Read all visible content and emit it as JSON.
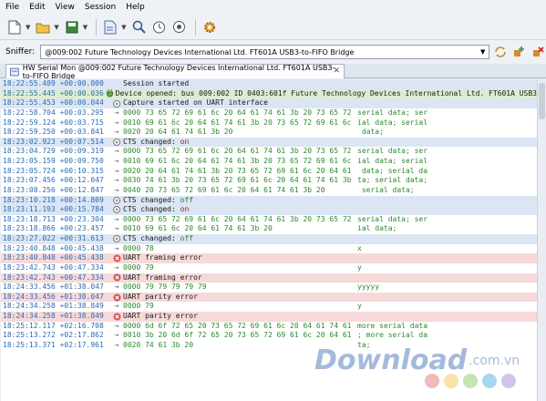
{
  "menu": {
    "file": "File",
    "edit": "Edit",
    "view": "View",
    "session": "Session",
    "help": "Help"
  },
  "toolbar": {
    "icons": [
      "new-icon",
      "open-folder-icon",
      "save-icon",
      "document-icon",
      "search-icon",
      "timer-icon",
      "capture-icon",
      "settings-gear-icon"
    ]
  },
  "sniffer": {
    "label": "Sniffer:",
    "value": "@009:002 Future Technology Devices International Ltd. FT601A USB3-to-FIFO Bridge"
  },
  "tab": {
    "title": "HW Serial Mon @009:002 Future Technology Devices International Ltd. FT601A USB3-to-FIFO Bridge",
    "close": "✕"
  },
  "log": [
    {
      "ts": "18:22:55.409 +00:00.000",
      "icon": "",
      "bg": "blue",
      "msg": "Session started"
    },
    {
      "ts": "18:22:55.445 +00:00.036",
      "icon": "plug",
      "bg": "green",
      "msg": "Device opened: bus 009:002 ID 0403:601f Future Technology Devices International Ltd. FT601A USB3"
    },
    {
      "ts": "18:22:55.453 +00:00.044",
      "icon": "info",
      "bg": "blue",
      "msg": "Capture started on UART interface"
    },
    {
      "ts": "18:22:58.704 +00:03.295",
      "icon": "arrow",
      "bg": "white",
      "hex": "0000 73 65 72 69 61 6c 20 64 61 74 61 3b 20 73 65 72",
      "asc": "serial data; ser"
    },
    {
      "ts": "18:22:59.124 +00:03.715",
      "icon": "arrow",
      "bg": "white",
      "hex": "0010 69 61 6c 20 64 61 74 61 3b 20 73 65 72 69 61 6c",
      "asc": "ial data; serial"
    },
    {
      "ts": "18:22:59.250 +00:03.841",
      "icon": "arrow",
      "bg": "white",
      "hex": "0020 20 64 61 74 61 3b 20",
      "asc": " data;"
    },
    {
      "ts": "18:23:02.923 +00:07.514",
      "icon": "info",
      "bg": "blue",
      "msg": "CTS changed: ",
      "state": "on",
      "state_type": "on"
    },
    {
      "ts": "18:23:04.729 +00:09.319",
      "icon": "arrow",
      "bg": "white",
      "hex": "0000 73 65 72 69 61 6c 20 64 61 74 61 3b 20 73 65 72",
      "asc": "serial data; ser"
    },
    {
      "ts": "18:23:05.159 +00:09.750",
      "icon": "arrow",
      "bg": "white",
      "hex": "0010 69 61 6c 20 64 61 74 61 3b 20 73 65 72 69 61 6c",
      "asc": "ial data; serial"
    },
    {
      "ts": "18:23:05.724 +00:10.315",
      "icon": "arrow",
      "bg": "white",
      "hex": "0020 20 64 61 74 61 3b 20 73 65 72 69 61 6c 20 64 61",
      "asc": " data; serial da"
    },
    {
      "ts": "18:23:07.456 +00:12.047",
      "icon": "arrow",
      "bg": "white",
      "hex": "0030 74 61 3b 20 73 65 72 69 61 6c 20 64 61 74 61 3b",
      "asc": "ta; serial data;"
    },
    {
      "ts": "18:23:08.256 +00:12.847",
      "icon": "arrow",
      "bg": "white",
      "hex": "0040 20 73 65 72 69 61 6c 20 64 61 74 61 3b 20",
      "asc": " serial data;"
    },
    {
      "ts": "18:23:10.218 +00:14.809",
      "icon": "info",
      "bg": "blue",
      "msg": "CTS changed: ",
      "state": "off",
      "state_type": "off"
    },
    {
      "ts": "18:23:11.193 +00:15.784",
      "icon": "info",
      "bg": "blue",
      "msg": "CTS changed: ",
      "state": "on",
      "state_type": "on"
    },
    {
      "ts": "18:23:18.713 +00:23.304",
      "icon": "arrow",
      "bg": "white",
      "hex": "0000 73 65 72 69 61 6c 20 64 61 74 61 3b 20 73 65 72",
      "asc": "serial data; ser"
    },
    {
      "ts": "18:23:18.866 +00:23.457",
      "icon": "arrow",
      "bg": "white",
      "hex": "0010 69 61 6c 20 64 61 74 61 3b 20",
      "asc": "ial data;"
    },
    {
      "ts": "18:23:27.022 +00:31.613",
      "icon": "info",
      "bg": "blue",
      "msg": "CTS changed: ",
      "state": "off",
      "state_type": "off"
    },
    {
      "ts": "18:23:40.848 +00:45.438",
      "icon": "arrow",
      "bg": "white",
      "hex": "0000 78",
      "asc": "x"
    },
    {
      "ts": "18:23:40.848 +00:45.438",
      "icon": "error",
      "bg": "red",
      "msg": "UART framing error"
    },
    {
      "ts": "18:23:42.743 +00:47.334",
      "icon": "arrow",
      "bg": "white",
      "hex": "0000 79",
      "asc": "y"
    },
    {
      "ts": "18:23:42.743 +00:47.334",
      "icon": "error",
      "bg": "red",
      "msg": "UART framing error"
    },
    {
      "ts": "18:24:33.456 +01:38.047",
      "icon": "arrow",
      "bg": "white",
      "hex": "0000 79 79 79 79 79",
      "asc": "yyyyy"
    },
    {
      "ts": "18:24:33.456 +01:38.047",
      "icon": "error",
      "bg": "red",
      "msg": "UART parity error"
    },
    {
      "ts": "18:24:34.258 +01:38.849",
      "icon": "arrow",
      "bg": "white",
      "hex": "0000 79",
      "asc": "y"
    },
    {
      "ts": "18:24:34.258 +01:38.849",
      "icon": "error",
      "bg": "red",
      "msg": "UART parity error"
    },
    {
      "ts": "18:25:12.117 +02:16.708",
      "icon": "arrow",
      "bg": "white",
      "hex": "0000 6d 6f 72 65 20 73 65 72 69 61 6c 20 64 61 74 61",
      "asc": "more serial data"
    },
    {
      "ts": "18:25:13.272 +02:17.862",
      "icon": "arrow",
      "bg": "white",
      "hex": "0010 3b 20 6d 6f 72 65 20 73 65 72 69 61 6c 20 64 61",
      "asc": "; more serial da"
    },
    {
      "ts": "18:25:13.371 +02:17.961",
      "icon": "arrow",
      "bg": "white",
      "hex": "0020 74 61 3b 20",
      "asc": "ta;"
    }
  ],
  "watermark": {
    "text": "Download",
    "domain": ".com.vn"
  },
  "colors": {
    "timestamp": "#2c6db5",
    "hex_data": "#2d8a2d",
    "row_blue": "#dbe5f3",
    "row_green": "#dcedcf",
    "row_red": "#f6d9d9",
    "state_on": "#b01818",
    "state_off": "#2d7a2d",
    "dots": [
      "#f2b9b9",
      "#f7e3a8",
      "#c4e4b4",
      "#a8d6ee",
      "#d3c3ea"
    ]
  }
}
